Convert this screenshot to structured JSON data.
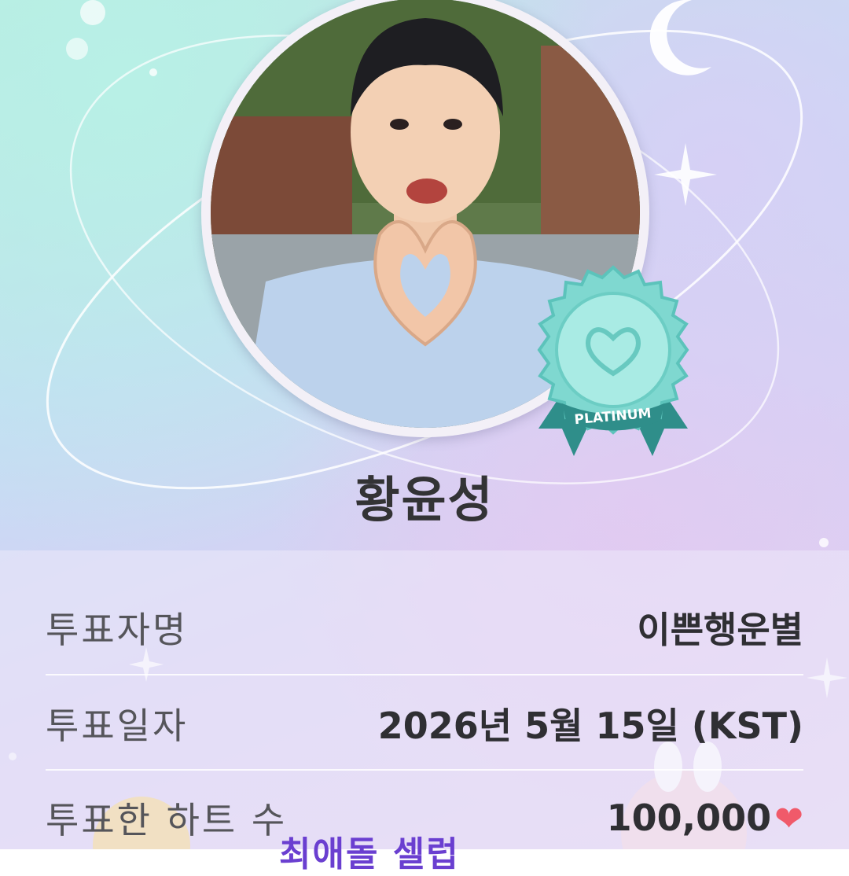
{
  "profile": {
    "name": "황윤성",
    "badge_label": "PLATINUM"
  },
  "details": [
    {
      "label": "투표자명",
      "value": "이쁜행운별"
    },
    {
      "label": "투표일자",
      "value": "2026년 5월 15일 (KST)"
    },
    {
      "label": "투표한 하트 수",
      "value": "100,000"
    }
  ],
  "footer": {
    "brand_text": "최애돌 셀럽"
  },
  "colors": {
    "badge_teal": "#7fd8d0",
    "badge_ribbon": "#2f8e8a",
    "heart": "#f05a6a",
    "brand": "#6a3fd0"
  },
  "icons": [
    "moon-icon",
    "sparkle-icon",
    "heart-icon",
    "badge-heart-icon"
  ]
}
